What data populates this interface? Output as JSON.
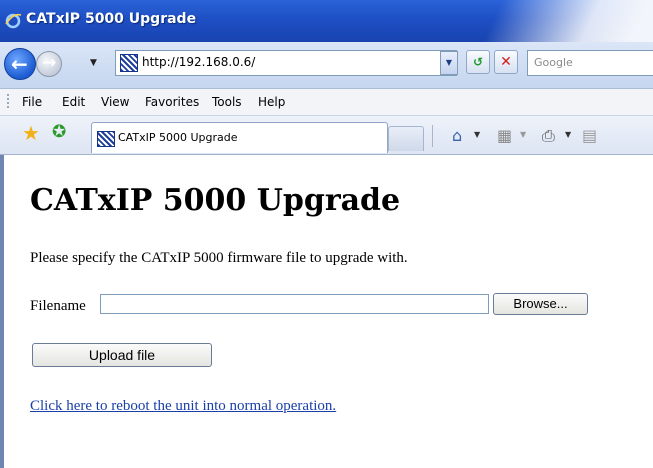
{
  "window": {
    "title": "CATxIP 5000 Upgrade"
  },
  "address": {
    "url": "http://192.168.0.6/",
    "search_placeholder": "Google"
  },
  "menu": [
    "File",
    "Edit",
    "View",
    "Favorites",
    "Tools",
    "Help"
  ],
  "tab": {
    "label": "CATxIP 5000 Upgrade"
  },
  "page": {
    "heading": "CATxIP 5000 Upgrade",
    "instructions": "Please specify the CATxIP 5000 firmware file to upgrade with.",
    "filename_label": "Filename",
    "filename_value": "",
    "browse_label": "Browse...",
    "upload_label": "Upload file",
    "reboot_link": "Click here to reboot the unit into normal operation."
  },
  "icons": {
    "browser": "ie-logo-icon",
    "back": "back-arrow-icon",
    "forward": "forward-arrow-icon",
    "refresh": "refresh-icon",
    "stop": "stop-icon",
    "favorites": "star-icon",
    "add_favorite": "add-favorite-icon",
    "home": "home-icon",
    "feeds": "rss-feed-icon",
    "print": "printer-icon"
  },
  "colors": {
    "titlebar": "#1e4fc4",
    "link": "#1a3fa9"
  }
}
